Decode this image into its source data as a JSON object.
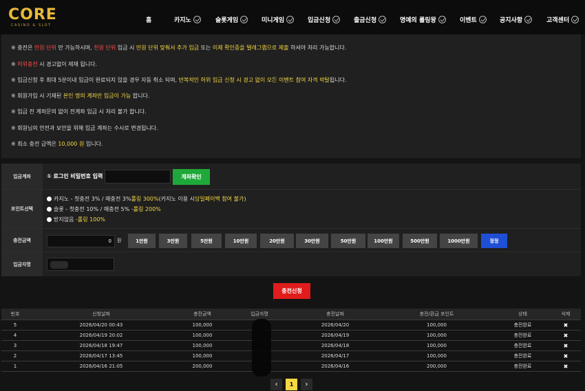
{
  "logo": {
    "main": "CORE",
    "sub": "CASINO & SLOT"
  },
  "nav": [
    "홈",
    "카지노",
    "슬롯게임",
    "미니게임",
    "입금신청",
    "출금신청",
    "명예의 롤링왕",
    "이벤트",
    "공지사항",
    "고객센터"
  ],
  "notices": {
    "n1": {
      "a": "※ 충전은 ",
      "b": "만원 단위",
      "c": " 만 가능하시며, ",
      "d": "천원 단위",
      "e": " 입금 시 ",
      "f": "만원 단위 맞춰서 추가 입금",
      "g": " 또는 ",
      "h": "이체 확인증을 텔레그램으로 제출",
      "i": " 하셔야 처리 가능합니다."
    },
    "n2": {
      "a": "※ ",
      "b": "허위충전",
      "c": " 시 경고없이 제재 됩니다."
    },
    "n3": {
      "a": "※ 입금신청 후 최대 5분이내 입금이 완료되지 않을 경우 자동 취소 되며, ",
      "b": "반복적인 허위 입금 신청 시 경고 없이 모든 이벤트 참여 자격 박탈",
      "c": "됩니다."
    },
    "n4": {
      "a": "※ 회원가입 시 기재된 ",
      "b": "본인 명의 계좌만 입금이 가능",
      "c": " 합니다."
    },
    "n5": {
      "a": "※ 입금 전 계좌문의 없이 전계좌 입금 시 처리 불가 합니다."
    },
    "n6": {
      "a": "※ 회원님의 안전과 보안을 위해 입금 계좌는 수시로 변경됩니다."
    },
    "n7": {
      "a": "※ 최소 충전 금액은 ",
      "b": "10,000 원",
      "c": " 입니다."
    }
  },
  "form": {
    "account_label": "입금계좌",
    "pw_label": "① 로그인 비밀번호 입력",
    "confirm_button": "계좌확인",
    "point_label": "포인트선택",
    "opt1": {
      "a": "카지노 - 첫충전 3% / 매충전 3% ",
      "b": "롤링 300%",
      "c": " (카지노 이용 시 ",
      "d": "당일페이백 참여 불가",
      "e": ")"
    },
    "opt2": {
      "a": "슬롯 - 첫충전 10% / 매충전 5% - ",
      "b": "롤링 200%"
    },
    "opt3": {
      "a": "받지않음 - ",
      "b": "롤링 100%"
    },
    "amount_label": "충전금액",
    "amount_value": "0",
    "won": "원",
    "amount_buttons": [
      "1만원",
      "3만원",
      "5만원",
      "10만원",
      "20만원",
      "30만원",
      "50만원",
      "100만원",
      "500만원",
      "1000만원"
    ],
    "reset_button": "정정",
    "name_label": "입금자명"
  },
  "submit_button": "충전신청",
  "table": {
    "headers": [
      "번호",
      "신청날짜",
      "충전금액",
      "입금자명",
      "충전날짜",
      "충전/환급 포인트",
      "상태",
      "삭제"
    ],
    "rows": [
      [
        "5",
        "2026/04/20 00:43",
        "100,000",
        "",
        "2026/04/20",
        "100,000",
        "충전완료",
        "✖"
      ],
      [
        "4",
        "2026/04/19 20:02",
        "100,000",
        "",
        "2026/04/19",
        "100,000",
        "충전완료",
        "✖"
      ],
      [
        "3",
        "2026/04/18 19:47",
        "100,000",
        "",
        "2026/04/18",
        "100,000",
        "충전완료",
        "✖"
      ],
      [
        "2",
        "2026/04/17 13:45",
        "100,000",
        "",
        "2026/04/17",
        "100,000",
        "충전완료",
        "✖"
      ],
      [
        "1",
        "2026/04/16 21:05",
        "200,000",
        "",
        "2026/04/16",
        "200,000",
        "충전완료",
        "✖"
      ]
    ]
  },
  "pager": {
    "prev": "‹",
    "current": "1",
    "next": "›"
  }
}
